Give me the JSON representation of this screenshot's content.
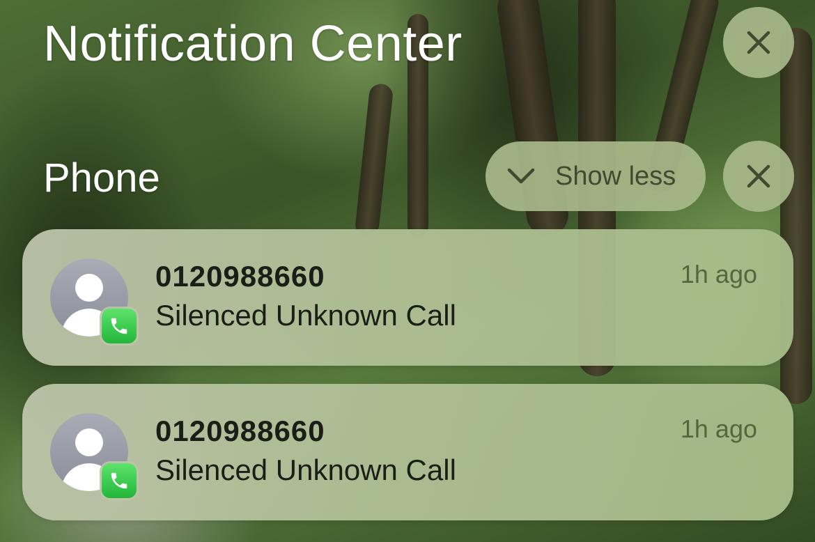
{
  "header": {
    "title": "Notification Center",
    "close_label": "Close Notification Center"
  },
  "group": {
    "title": "Phone",
    "show_less_label": "Show less",
    "clear_label": "Clear Phone notifications"
  },
  "notifications": [
    {
      "caller": "0120988660",
      "message": "Silenced Unknown Call",
      "time": "1h ago",
      "app_icon": "phone-icon",
      "avatar_icon": "person-icon"
    },
    {
      "caller": "0120988660",
      "message": "Silenced Unknown Call",
      "time": "1h ago",
      "app_icon": "phone-icon",
      "avatar_icon": "person-icon"
    }
  ],
  "colors": {
    "button_bg": "#a8b98a",
    "button_icon": "#3f4a30",
    "phone_badge": "#2fc247",
    "time_text": "#56653f"
  }
}
